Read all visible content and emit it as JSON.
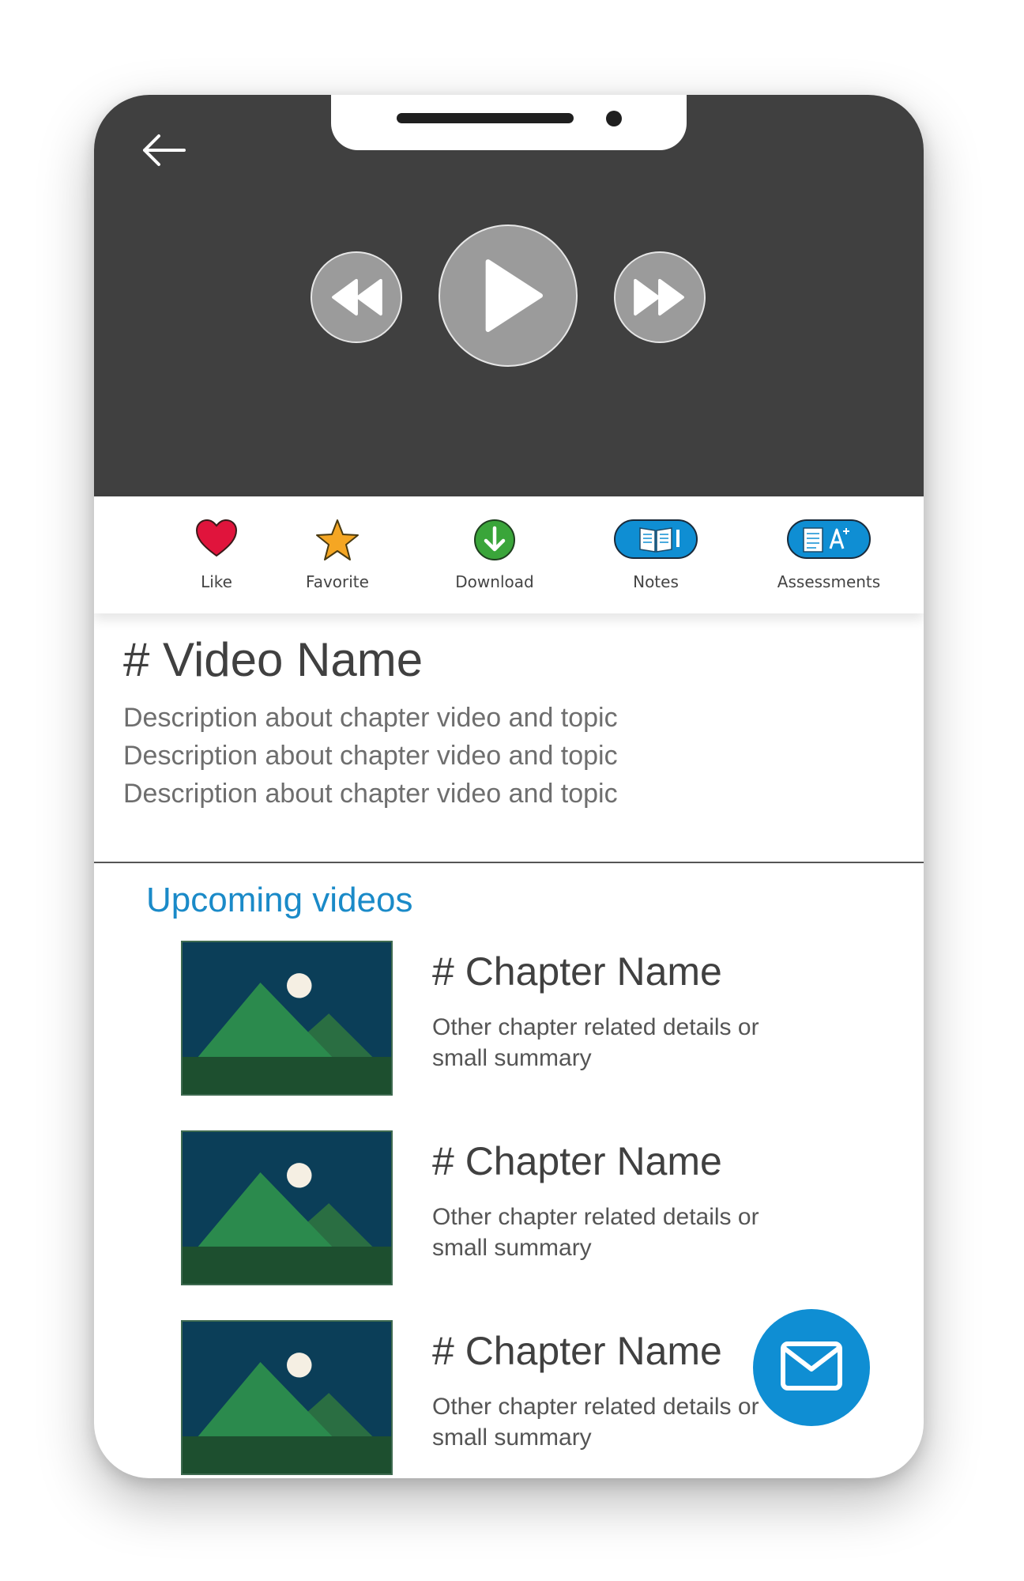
{
  "player": {
    "back_icon": "arrow-left-icon",
    "rewind_icon": "rewind-icon",
    "play_icon": "play-icon",
    "forward_icon": "fast-forward-icon"
  },
  "actions": [
    {
      "label": "Like",
      "icon": "heart-icon",
      "color": "#e0143c"
    },
    {
      "label": "Favorite",
      "icon": "star-icon",
      "color": "#f5a623"
    },
    {
      "label": "Download",
      "icon": "download-icon",
      "color": "#3aa53a"
    },
    {
      "label": "Notes",
      "icon": "notes-book-icon",
      "color": "#0f8ed3"
    },
    {
      "label": "Assessments",
      "icon": "assessment-grade-icon",
      "color": "#0f8ed3"
    }
  ],
  "video": {
    "title": "# Video Name",
    "description": "Description about chapter video and topic Description about chapter video and topic Description about chapter video and topic"
  },
  "upcoming": {
    "heading": "Upcoming videos",
    "heading_color": "#1a8ac8",
    "items": [
      {
        "title": "# Chapter Name",
        "summary": "Other chapter related details or small summary",
        "thumbnail_icon": "image-placeholder-icon"
      },
      {
        "title": "# Chapter Name",
        "summary": "Other chapter related details or small summary",
        "thumbnail_icon": "image-placeholder-icon"
      },
      {
        "title": "# Chapter Name",
        "summary": "Other chapter related details or small summary",
        "thumbnail_icon": "image-placeholder-icon"
      }
    ]
  },
  "fab": {
    "icon": "mail-icon",
    "color": "#0f8ed3"
  },
  "colors": {
    "player_bg": "#404040",
    "accent": "#0f8ed3"
  }
}
